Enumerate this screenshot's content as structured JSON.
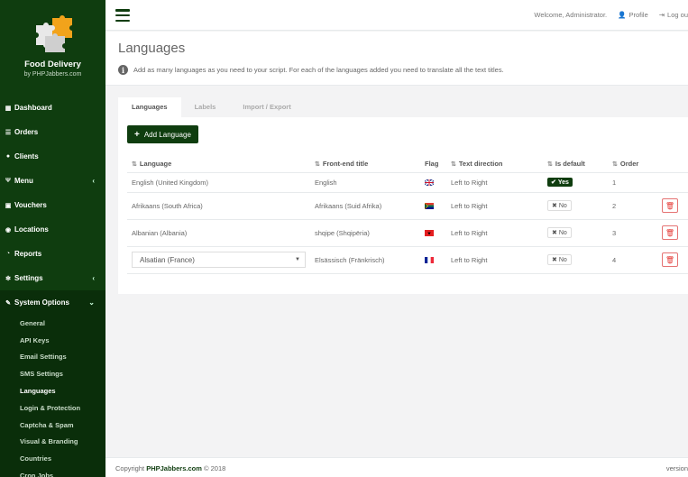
{
  "app": {
    "brand": "Food Delivery",
    "brand_sub": "by PHPJabbers.com",
    "accent_color": "#0f3d0f"
  },
  "topbar": {
    "welcome": "Welcome, Administrator.",
    "profile": "Profile",
    "logout": "Log ou"
  },
  "sidebar": {
    "items": [
      {
        "label": "Dashboard",
        "icon": "grid-icon"
      },
      {
        "label": "Orders",
        "icon": "list-icon"
      },
      {
        "label": "Clients",
        "icon": "user-icon"
      },
      {
        "label": "Menu",
        "icon": "cutlery-icon",
        "has_children": true
      },
      {
        "label": "Vouchers",
        "icon": "gift-icon"
      },
      {
        "label": "Locations",
        "icon": "map-marker-icon"
      },
      {
        "label": "Reports",
        "icon": "chart-icon"
      },
      {
        "label": "Settings",
        "icon": "gears-icon",
        "has_children": true
      },
      {
        "label": "System Options",
        "icon": "wrench-icon",
        "has_children": true,
        "expanded": true
      }
    ],
    "sub_items": [
      "General",
      "API Keys",
      "Email Settings",
      "SMS Settings",
      "Languages",
      "Login & Protection",
      "Captcha & Spam",
      "Visual & Branding",
      "Countries",
      "Cron Jobs"
    ],
    "active_sub": "Languages"
  },
  "page": {
    "title": "Languages",
    "description": "Add as many languages as you need to your script. For each of the languages added you need to translate all the text titles."
  },
  "tabs": [
    "Languages",
    "Labels",
    "Import / Export"
  ],
  "toolbar": {
    "add_label": "Add Language"
  },
  "table": {
    "headers": {
      "language": "Language",
      "frontend_title": "Front-end title",
      "flag": "Flag",
      "text_direction": "Text direction",
      "is_default": "Is default",
      "order": "Order"
    },
    "rows": [
      {
        "language": "English (United Kingdom)",
        "title": "English",
        "flag": "gb",
        "direction": "Left to Right",
        "is_default": "Yes",
        "order": "1"
      },
      {
        "language": "Afrikaans (South Africa)",
        "title": "Afrikaans (Suid Afrika)",
        "flag": "za",
        "direction": "Left to Right",
        "is_default": "No",
        "order": "2"
      },
      {
        "language": "Albanian (Albania)",
        "title": "shqipe (Shqipëria)",
        "flag": "al",
        "direction": "Left to Right",
        "is_default": "No",
        "order": "3"
      },
      {
        "language": "Alsatian (France)",
        "title": "Elsässisch (Fränkrisch)",
        "flag": "fr",
        "direction": "Left to Right",
        "is_default": "No",
        "order": "4"
      }
    ]
  },
  "footer": {
    "copyright_prefix": "Copyright",
    "copyright_link": "PHPJabbers.com",
    "copyright_suffix": "© 2018",
    "version": "version"
  }
}
